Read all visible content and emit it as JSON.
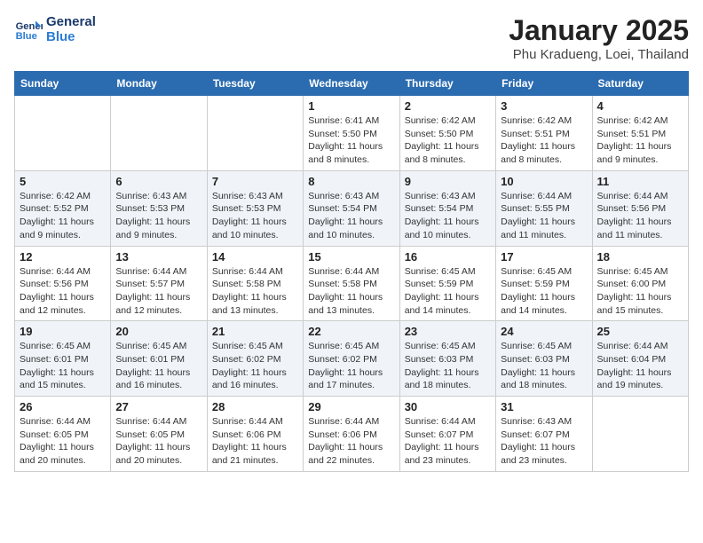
{
  "header": {
    "logo_line1": "General",
    "logo_line2": "Blue",
    "title": "January 2025",
    "subtitle": "Phu Kradueng, Loei, Thailand"
  },
  "weekdays": [
    "Sunday",
    "Monday",
    "Tuesday",
    "Wednesday",
    "Thursday",
    "Friday",
    "Saturday"
  ],
  "weeks": [
    [
      {
        "day": "",
        "info": ""
      },
      {
        "day": "",
        "info": ""
      },
      {
        "day": "",
        "info": ""
      },
      {
        "day": "1",
        "info": "Sunrise: 6:41 AM\nSunset: 5:50 PM\nDaylight: 11 hours and 8 minutes."
      },
      {
        "day": "2",
        "info": "Sunrise: 6:42 AM\nSunset: 5:50 PM\nDaylight: 11 hours and 8 minutes."
      },
      {
        "day": "3",
        "info": "Sunrise: 6:42 AM\nSunset: 5:51 PM\nDaylight: 11 hours and 8 minutes."
      },
      {
        "day": "4",
        "info": "Sunrise: 6:42 AM\nSunset: 5:51 PM\nDaylight: 11 hours and 9 minutes."
      }
    ],
    [
      {
        "day": "5",
        "info": "Sunrise: 6:42 AM\nSunset: 5:52 PM\nDaylight: 11 hours and 9 minutes."
      },
      {
        "day": "6",
        "info": "Sunrise: 6:43 AM\nSunset: 5:53 PM\nDaylight: 11 hours and 9 minutes."
      },
      {
        "day": "7",
        "info": "Sunrise: 6:43 AM\nSunset: 5:53 PM\nDaylight: 11 hours and 10 minutes."
      },
      {
        "day": "8",
        "info": "Sunrise: 6:43 AM\nSunset: 5:54 PM\nDaylight: 11 hours and 10 minutes."
      },
      {
        "day": "9",
        "info": "Sunrise: 6:43 AM\nSunset: 5:54 PM\nDaylight: 11 hours and 10 minutes."
      },
      {
        "day": "10",
        "info": "Sunrise: 6:44 AM\nSunset: 5:55 PM\nDaylight: 11 hours and 11 minutes."
      },
      {
        "day": "11",
        "info": "Sunrise: 6:44 AM\nSunset: 5:56 PM\nDaylight: 11 hours and 11 minutes."
      }
    ],
    [
      {
        "day": "12",
        "info": "Sunrise: 6:44 AM\nSunset: 5:56 PM\nDaylight: 11 hours and 12 minutes."
      },
      {
        "day": "13",
        "info": "Sunrise: 6:44 AM\nSunset: 5:57 PM\nDaylight: 11 hours and 12 minutes."
      },
      {
        "day": "14",
        "info": "Sunrise: 6:44 AM\nSunset: 5:58 PM\nDaylight: 11 hours and 13 minutes."
      },
      {
        "day": "15",
        "info": "Sunrise: 6:44 AM\nSunset: 5:58 PM\nDaylight: 11 hours and 13 minutes."
      },
      {
        "day": "16",
        "info": "Sunrise: 6:45 AM\nSunset: 5:59 PM\nDaylight: 11 hours and 14 minutes."
      },
      {
        "day": "17",
        "info": "Sunrise: 6:45 AM\nSunset: 5:59 PM\nDaylight: 11 hours and 14 minutes."
      },
      {
        "day": "18",
        "info": "Sunrise: 6:45 AM\nSunset: 6:00 PM\nDaylight: 11 hours and 15 minutes."
      }
    ],
    [
      {
        "day": "19",
        "info": "Sunrise: 6:45 AM\nSunset: 6:01 PM\nDaylight: 11 hours and 15 minutes."
      },
      {
        "day": "20",
        "info": "Sunrise: 6:45 AM\nSunset: 6:01 PM\nDaylight: 11 hours and 16 minutes."
      },
      {
        "day": "21",
        "info": "Sunrise: 6:45 AM\nSunset: 6:02 PM\nDaylight: 11 hours and 16 minutes."
      },
      {
        "day": "22",
        "info": "Sunrise: 6:45 AM\nSunset: 6:02 PM\nDaylight: 11 hours and 17 minutes."
      },
      {
        "day": "23",
        "info": "Sunrise: 6:45 AM\nSunset: 6:03 PM\nDaylight: 11 hours and 18 minutes."
      },
      {
        "day": "24",
        "info": "Sunrise: 6:45 AM\nSunset: 6:03 PM\nDaylight: 11 hours and 18 minutes."
      },
      {
        "day": "25",
        "info": "Sunrise: 6:44 AM\nSunset: 6:04 PM\nDaylight: 11 hours and 19 minutes."
      }
    ],
    [
      {
        "day": "26",
        "info": "Sunrise: 6:44 AM\nSunset: 6:05 PM\nDaylight: 11 hours and 20 minutes."
      },
      {
        "day": "27",
        "info": "Sunrise: 6:44 AM\nSunset: 6:05 PM\nDaylight: 11 hours and 20 minutes."
      },
      {
        "day": "28",
        "info": "Sunrise: 6:44 AM\nSunset: 6:06 PM\nDaylight: 11 hours and 21 minutes."
      },
      {
        "day": "29",
        "info": "Sunrise: 6:44 AM\nSunset: 6:06 PM\nDaylight: 11 hours and 22 minutes."
      },
      {
        "day": "30",
        "info": "Sunrise: 6:44 AM\nSunset: 6:07 PM\nDaylight: 11 hours and 23 minutes."
      },
      {
        "day": "31",
        "info": "Sunrise: 6:43 AM\nSunset: 6:07 PM\nDaylight: 11 hours and 23 minutes."
      },
      {
        "day": "",
        "info": ""
      }
    ]
  ]
}
